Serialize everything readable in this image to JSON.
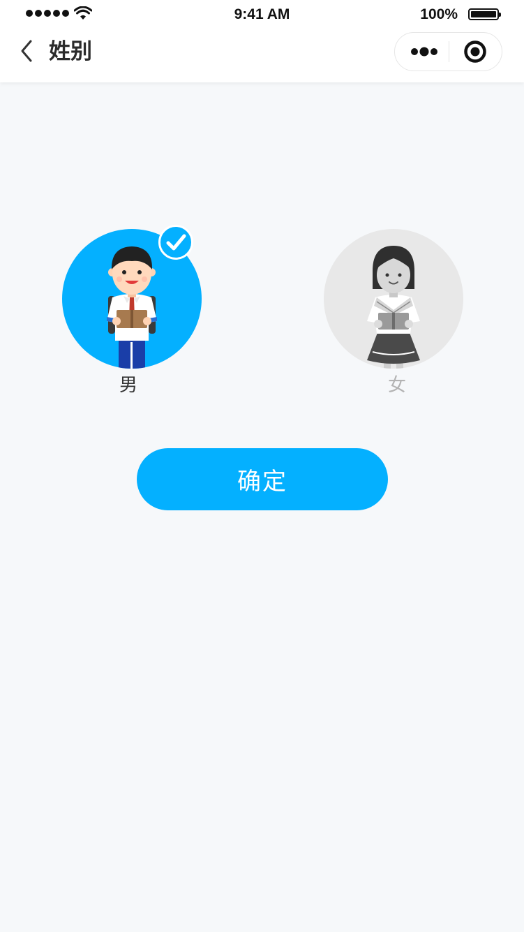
{
  "status_bar": {
    "time": "9:41 AM",
    "battery": "100%"
  },
  "nav": {
    "title": "姓别",
    "back_icon": "chevron-left-icon",
    "more_icon": "more-dots-icon",
    "close_icon": "target-circle-icon"
  },
  "options": [
    {
      "label": "男",
      "selected": true,
      "avatar": "boy-student-avatar"
    },
    {
      "label": "女",
      "selected": false,
      "avatar": "girl-student-avatar"
    }
  ],
  "confirm_button": {
    "label": "确定"
  },
  "colors": {
    "accent": "#04b0ff",
    "background": "#f6f8fa",
    "unselected_circle": "#e8e8e8",
    "unselected_label": "#b3b3b3"
  }
}
